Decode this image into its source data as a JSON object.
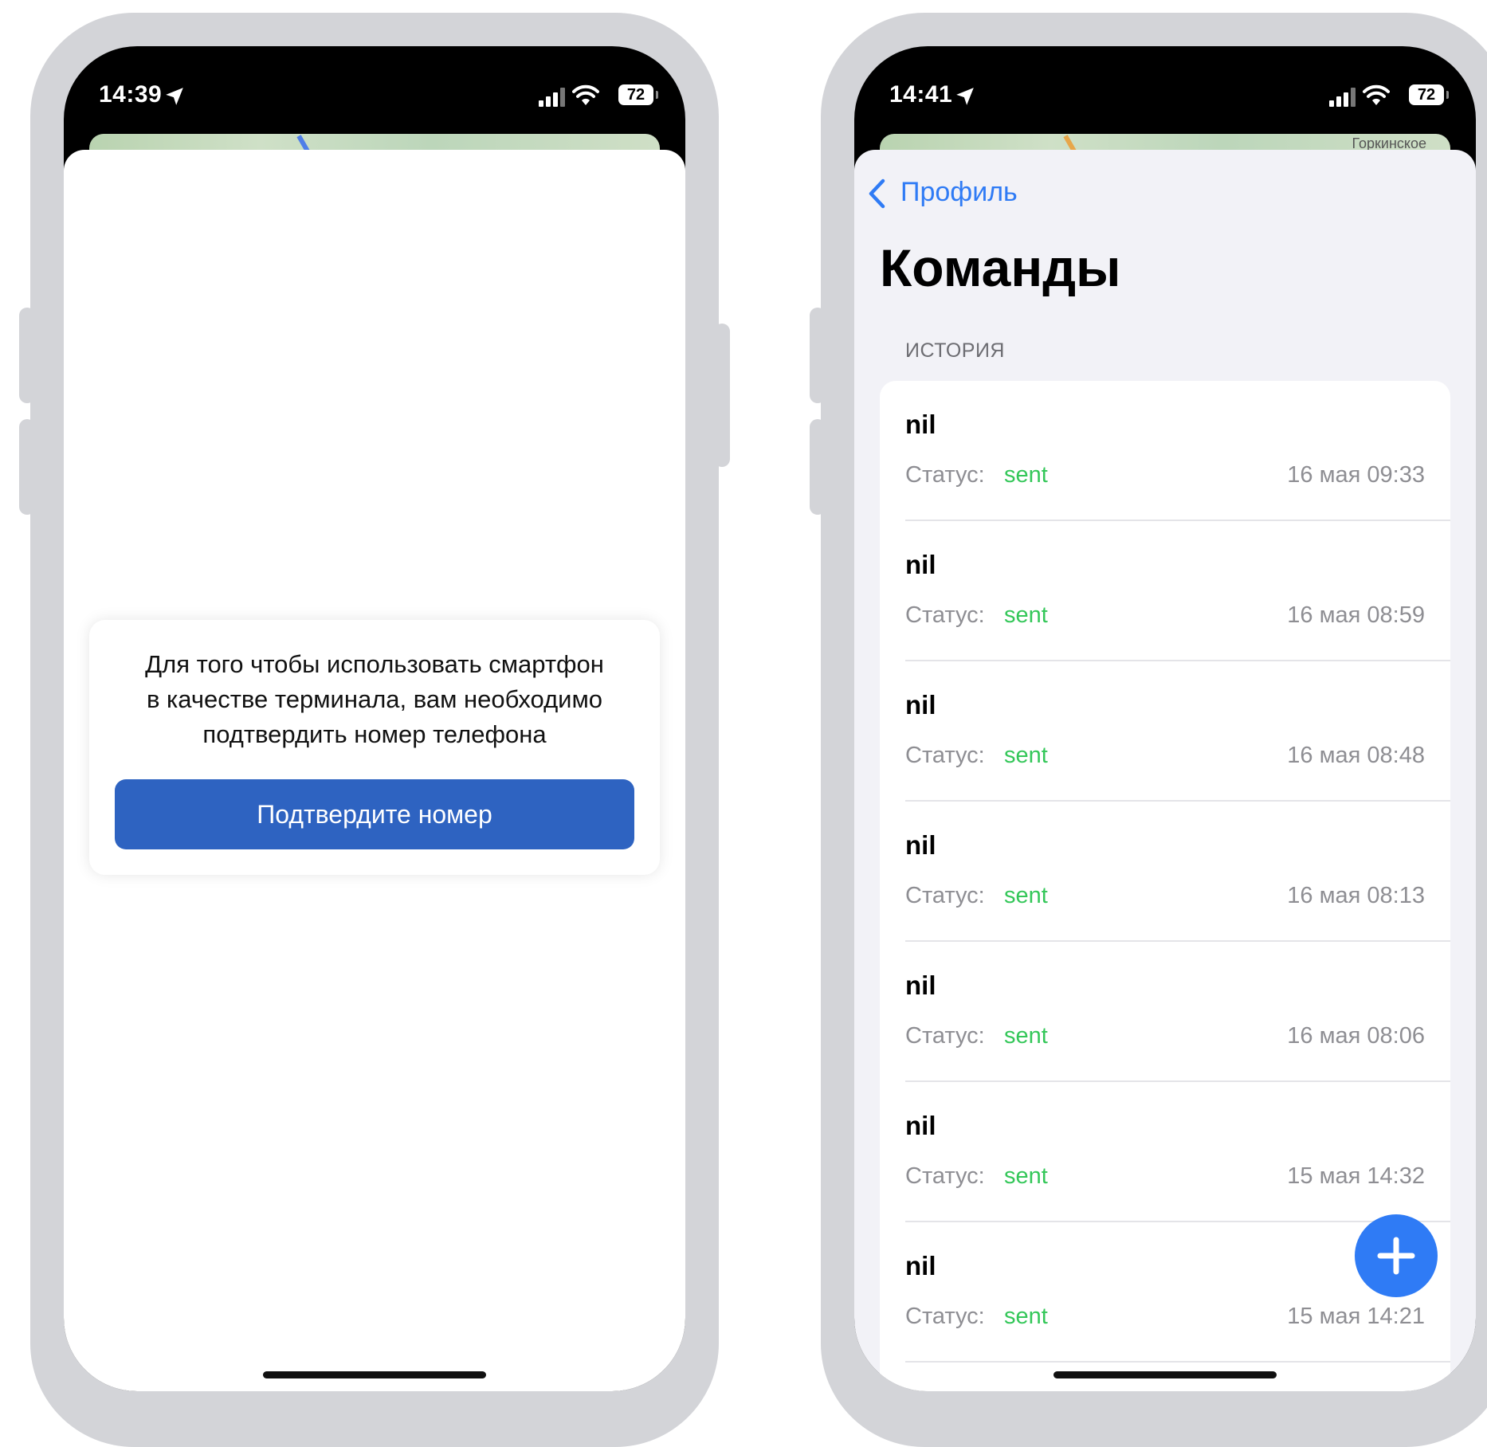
{
  "left_phone": {
    "status_bar": {
      "time": "14:39",
      "battery": "72"
    },
    "verify_card": {
      "message_line1": "Для того чтобы использовать смартфон",
      "message_line2": "в качестве терминала, вам необходимо",
      "message_line3": "подтвердить номер телефона",
      "button_label": "Подтвердите номер"
    }
  },
  "right_phone": {
    "status_bar": {
      "time": "14:41",
      "battery": "72"
    },
    "map_label": "Горкинское",
    "nav": {
      "back_label": "Профиль"
    },
    "title": "Команды",
    "section_header": "ИСТОРИЯ",
    "status_label": "Статус:",
    "rows": [
      {
        "title": "nil",
        "status": "sent",
        "date": "16 мая 09:33"
      },
      {
        "title": "nil",
        "status": "sent",
        "date": "16 мая 08:59"
      },
      {
        "title": "nil",
        "status": "sent",
        "date": "16 мая 08:48"
      },
      {
        "title": "nil",
        "status": "sent",
        "date": "16 мая 08:13"
      },
      {
        "title": "nil",
        "status": "sent",
        "date": "16 мая 08:06"
      },
      {
        "title": "nil",
        "status": "sent",
        "date": "15 мая 14:32"
      },
      {
        "title": "nil",
        "status": "sent",
        "date": "15 мая 14:21"
      }
    ],
    "fab_icon": "plus-icon"
  },
  "colors": {
    "accent_blue": "#2f7bf5",
    "button_blue": "#2e63c1",
    "status_green": "#34c759",
    "frame_gray": "#d3d4d8"
  }
}
